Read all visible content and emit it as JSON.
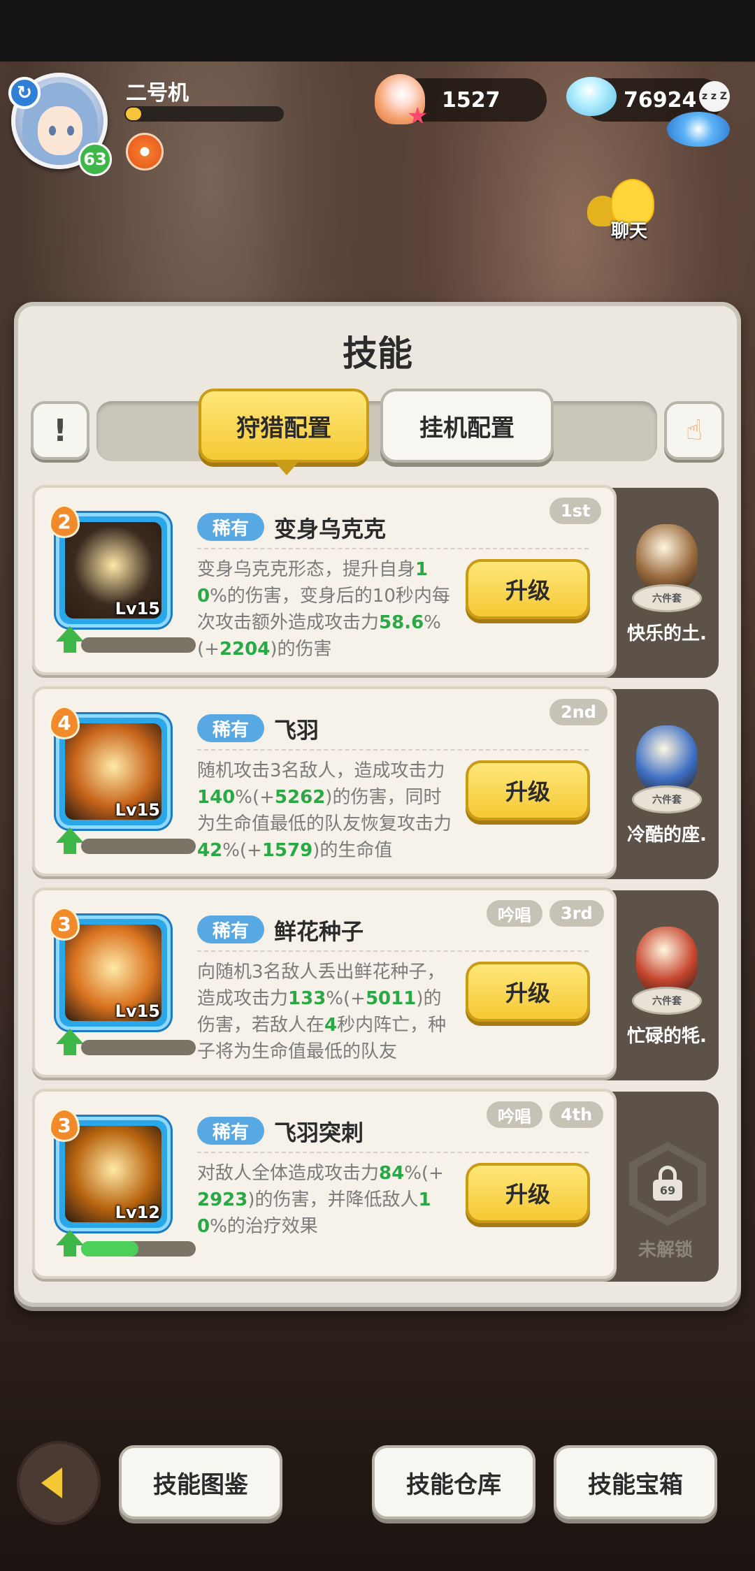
{
  "player": {
    "name": "二号机",
    "level": "63",
    "xp_fraction": 0.1
  },
  "currency": {
    "shell_amount": "1527",
    "gem_amount": "76924"
  },
  "chat": {
    "label": "聊天"
  },
  "panel": {
    "title": "技能"
  },
  "tabs": [
    {
      "label": "狩猎配置",
      "active": true
    },
    {
      "label": "挂机配置",
      "active": false
    }
  ],
  "skills": [
    {
      "slot": "2",
      "rarity": "稀有",
      "name": "变身乌克克",
      "level": "Lv15",
      "rank": "1st",
      "chant": "",
      "desc_parts": [
        "变身乌克克形态，提升自身",
        "10",
        "%的伤害，变身后的10秒内每次攻击额外造成攻击力",
        "58.6",
        "%(+",
        "2204",
        ")的伤害"
      ],
      "upgrade_label": "升级",
      "progress": 0.0,
      "art_color": "#3b2a20"
    },
    {
      "slot": "4",
      "rarity": "稀有",
      "name": "飞羽",
      "level": "Lv15",
      "rank": "2nd",
      "chant": "",
      "desc_parts": [
        "随机攻击3名敌人，造成攻击力",
        "140",
        "%(+",
        "5262",
        ")的伤害，同时为生命值最低的队友恢复攻击力",
        "42",
        "%(+",
        "1579",
        ")的生命值"
      ],
      "upgrade_label": "升级",
      "progress": 0.0,
      "art_color": "#c7641a"
    },
    {
      "slot": "3",
      "rarity": "稀有",
      "name": "鲜花种子",
      "level": "Lv15",
      "rank": "3rd",
      "chant": "吟唱",
      "desc_parts": [
        "向随机3名敌人丢出鲜花种子，造成攻击力",
        "133",
        "%(+",
        "5011",
        ")的伤害，若敌人在",
        "4",
        "秒内阵亡，种子将为生命值最低的队友"
      ],
      "upgrade_label": "升级",
      "progress": 0.0,
      "art_color": "#d9731f"
    },
    {
      "slot": "3",
      "rarity": "稀有",
      "name": "飞羽突刺",
      "level": "Lv12",
      "rank": "4th",
      "chant": "吟唱",
      "desc_parts": [
        "对敌人全体造成攻击力",
        "84",
        "%(+",
        "2923",
        ")的伤害，并降低敌人",
        "10",
        "%的治疗效果"
      ],
      "upgrade_label": "升级",
      "progress": 0.5,
      "art_color": "#b8640f"
    }
  ],
  "pets": [
    {
      "set_label": "六件套",
      "name": "快乐的土.",
      "color": "#9a6a3e"
    },
    {
      "set_label": "六件套",
      "name": "冷酷的座.",
      "color": "#3d6fc4"
    },
    {
      "set_label": "六件套",
      "name": "忙碌的牦.",
      "color": "#c6452e"
    }
  ],
  "locked_slot": {
    "level": "69",
    "label": "未解锁"
  },
  "bottom_buttons": {
    "codex": "技能图鉴",
    "storage": "技能仓库",
    "chest": "技能宝箱"
  }
}
